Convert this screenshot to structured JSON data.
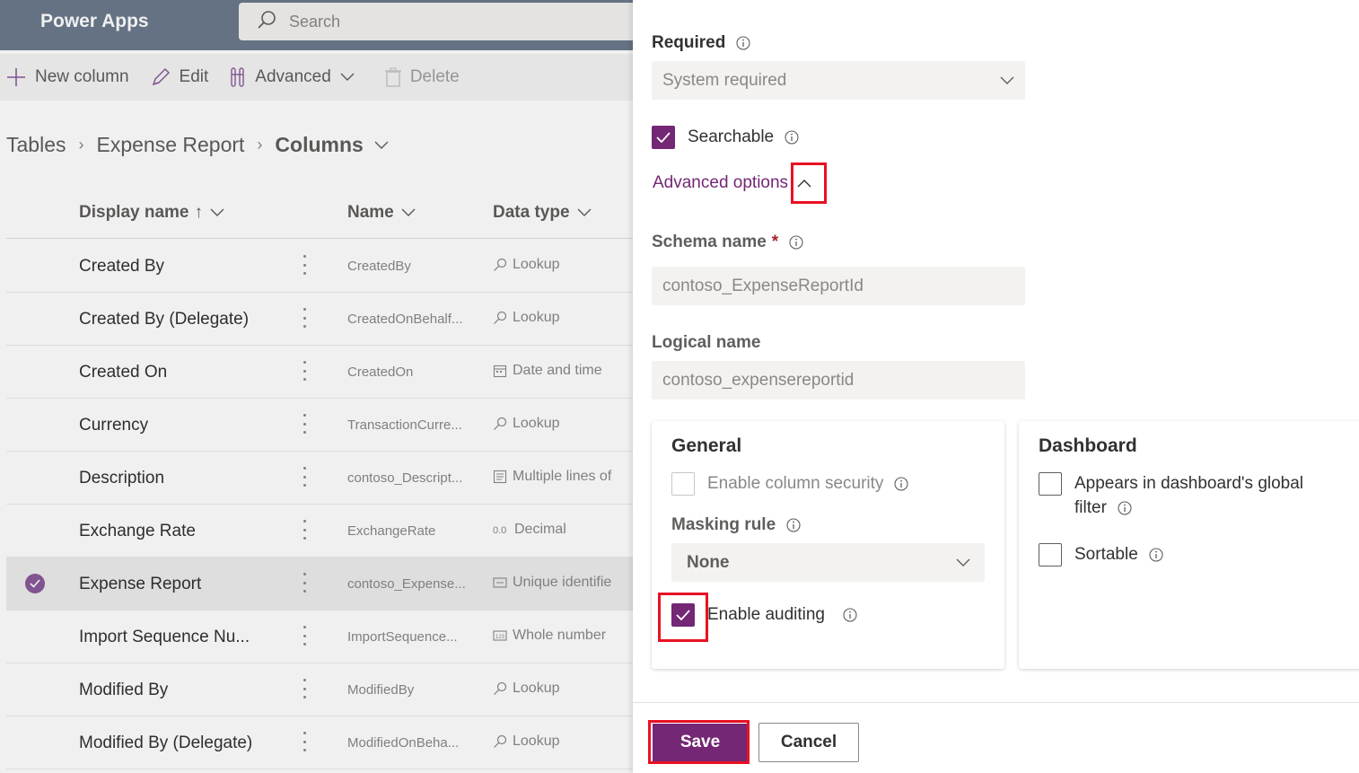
{
  "app": {
    "title": "Power Apps",
    "search_placeholder": "Search"
  },
  "commandbar": {
    "new_column": "New column",
    "edit": "Edit",
    "advanced": "Advanced",
    "delete": "Delete"
  },
  "breadcrumb": {
    "tables": "Tables",
    "table": "Expense Report",
    "current": "Columns"
  },
  "grid": {
    "headers": {
      "display_name": "Display name",
      "sort_indicator": "↑",
      "name": "Name",
      "data_type": "Data type"
    },
    "rows": [
      {
        "display": "Created By",
        "name": "CreatedBy",
        "type": "Lookup",
        "type_icon": "lookup-icon",
        "selected": false
      },
      {
        "display": "Created By (Delegate)",
        "name": "CreatedOnBehalf...",
        "type": "Lookup",
        "type_icon": "lookup-icon",
        "selected": false
      },
      {
        "display": "Created On",
        "name": "CreatedOn",
        "type": "Date and time",
        "type_icon": "calendar-icon",
        "selected": false
      },
      {
        "display": "Currency",
        "name": "TransactionCurre...",
        "type": "Lookup",
        "type_icon": "lookup-icon",
        "selected": false
      },
      {
        "display": "Description",
        "name": "contoso_Descript...",
        "type": "Multiple lines of",
        "type_icon": "multiline-icon",
        "selected": false
      },
      {
        "display": "Exchange Rate",
        "name": "ExchangeRate",
        "type": "Decimal",
        "type_icon": "decimal-icon",
        "selected": false
      },
      {
        "display": "Expense Report",
        "name": "contoso_Expense...",
        "type": "Unique identifie",
        "type_icon": "id-icon",
        "selected": true
      },
      {
        "display": "Import Sequence Nu...",
        "name": "ImportSequence...",
        "type": "Whole number",
        "type_icon": "number-icon",
        "selected": false
      },
      {
        "display": "Modified By",
        "name": "ModifiedBy",
        "type": "Lookup",
        "type_icon": "lookup-icon",
        "selected": false
      },
      {
        "display": "Modified By (Delegate)",
        "name": "ModifiedOnBeha...",
        "type": "Lookup",
        "type_icon": "lookup-icon",
        "selected": false
      }
    ]
  },
  "panel": {
    "required_label": "Required",
    "required_value": "System required",
    "searchable_label": "Searchable",
    "searchable_checked": true,
    "advanced_options_label": "Advanced options",
    "schema_name_label": "Schema name",
    "required_marker": "*",
    "schema_name_value": "contoso_ExpenseReportId",
    "logical_name_label": "Logical name",
    "logical_name_value": "contoso_expensereportid",
    "general": {
      "title": "General",
      "column_security_label": "Enable column security",
      "column_security_checked": false,
      "masking_rule_label": "Masking rule",
      "masking_rule_value": "None",
      "auditing_label": "Enable auditing",
      "auditing_checked": true
    },
    "dashboard": {
      "title": "Dashboard",
      "global_filter_label_1": "Appears in dashboard's global",
      "global_filter_label_2": "filter",
      "global_filter_checked": false,
      "sortable_label": "Sortable",
      "sortable_checked": false
    },
    "save_label": "Save",
    "cancel_label": "Cancel"
  },
  "colors": {
    "accent": "#742774",
    "highlight": "#e81123",
    "topbar": "#6b7a8c"
  }
}
